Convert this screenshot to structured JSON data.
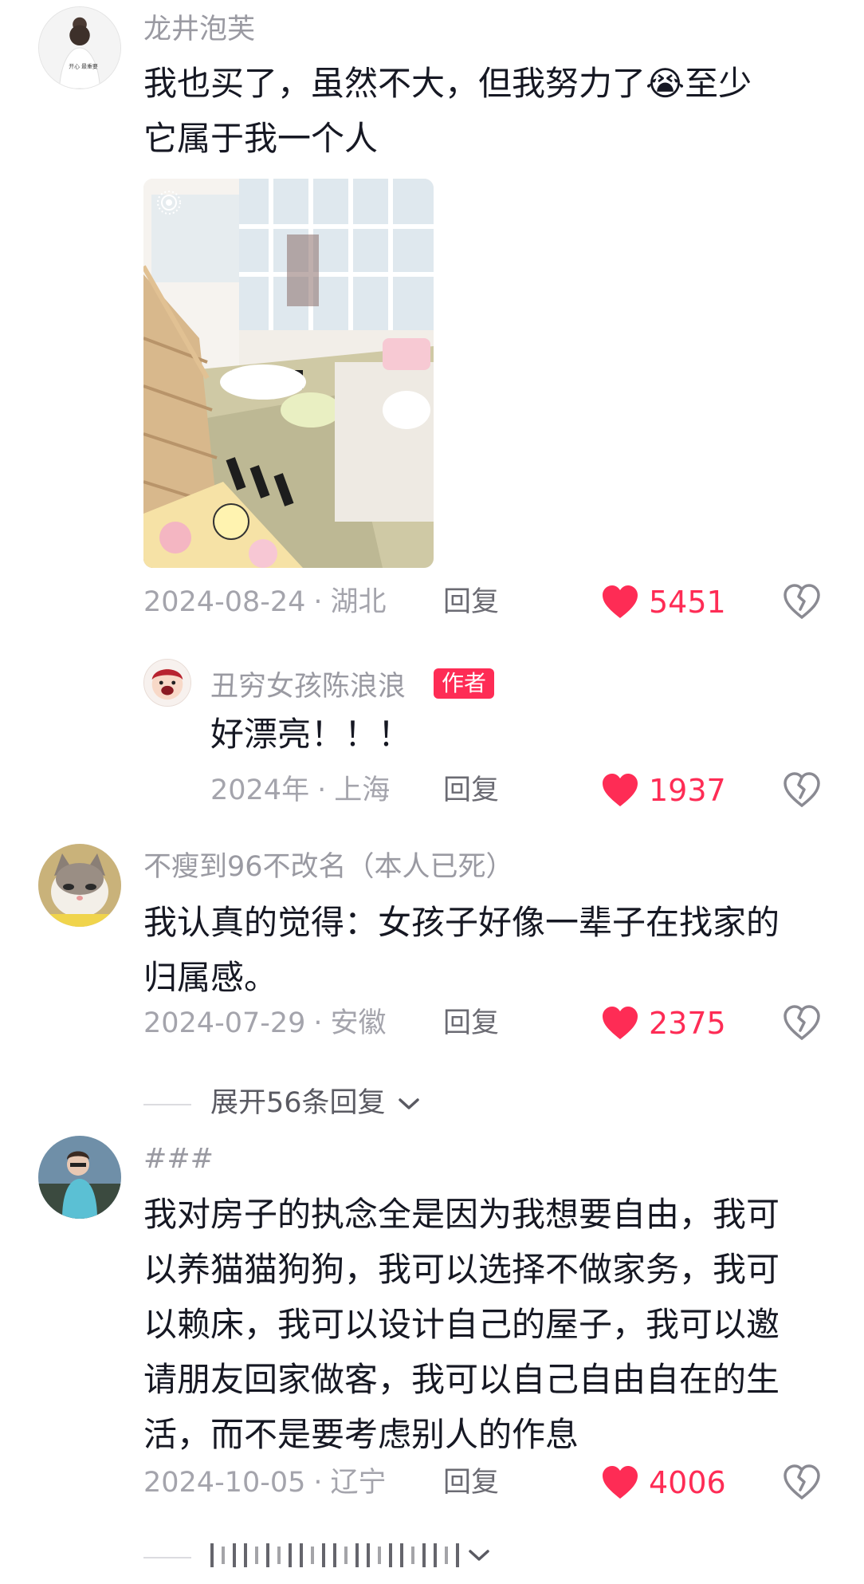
{
  "comments": [
    {
      "username": "龙井泡芙",
      "text_lines": [
        "我也买了，虽然不大，但我努力了😭至少",
        "它属于我一个人"
      ],
      "date": "2024-08-24",
      "region": "湖北",
      "reply_label": "回复",
      "likes": "5451",
      "avatar_caption": "开心 最重要"
    },
    {
      "username": "丑穷女孩陈浪浪",
      "author_badge": "作者",
      "text_lines": [
        "好漂亮！！！"
      ],
      "date": "2024年",
      "region": "上海",
      "reply_label": "回复",
      "likes": "1937"
    },
    {
      "username": "不瘦到96不改名（本人已死）",
      "text_lines": [
        "我认真的觉得：女孩子好像一辈子在找家的",
        "归属感。"
      ],
      "date": "2024-07-29",
      "region": "安徽",
      "reply_label": "回复",
      "likes": "2375",
      "expand_label": "展开56条回复"
    },
    {
      "username": "###",
      "text_lines": [
        "我对房子的执念全是因为我想要自由，我可",
        "以养猫猫狗狗，我可以选择不做家务，我可",
        "以赖床，我可以设计自己的屋子，我可以邀",
        "请朋友回家做客，我可以自己自由自在的生",
        "活，而不是要考虑别人的作息"
      ],
      "date": "2024-10-05",
      "region": "辽宁",
      "reply_label": "回复",
      "likes": "4006"
    }
  ],
  "separator": "·",
  "icons": {
    "like": "heart-filled-icon",
    "dislike": "broken-heart-icon",
    "expand": "chevron-down-icon",
    "photo_badge": "live-photo-icon"
  },
  "colors": {
    "accent": "#fe2c55",
    "username": "#9a9aa2",
    "meta": "#a4a4ac"
  }
}
